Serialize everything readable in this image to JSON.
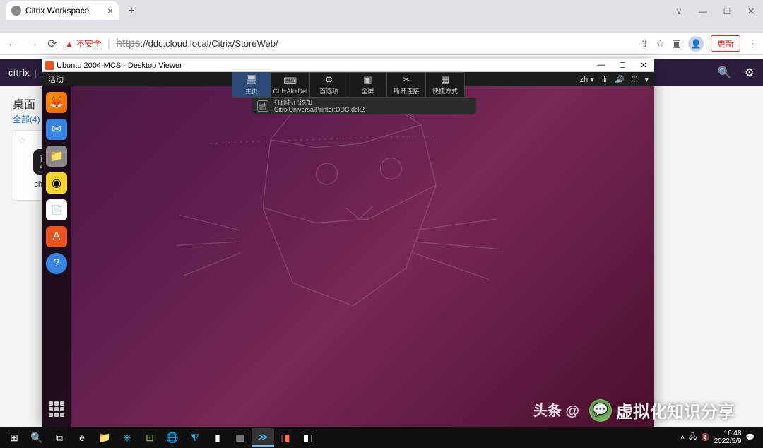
{
  "browser": {
    "tab_title": "Citrix Workspace",
    "security_label": "不安全",
    "url_struck": "https",
    "url": "://ddc.cloud.local/Citrix/StoreWeb/",
    "update_label": "更新"
  },
  "citrix": {
    "brand": "citrⅸ",
    "section": "Sto",
    "sidebar_title": "桌面",
    "sidebar_filter": "全部(4)",
    "card_label": "cheny"
  },
  "viewer": {
    "title": "Ubuntu 2004-MCS - Desktop Viewer",
    "toolbar": {
      "home": "主页",
      "cad": "Ctrl+Alt+Del",
      "prefs": "首选项",
      "fullscreen": "全屏",
      "disconnect": "断开连接",
      "shortcuts": "快捷方式"
    },
    "notif_title": "打印机已添加",
    "notif_body": "CitrixUniversalPrinter:DDC:dsk2"
  },
  "ubuntu": {
    "activities": "活动",
    "lang": "zh ▾"
  },
  "watermark": {
    "prefix": "头条 @",
    "text": "虚拟化知识分享"
  },
  "taskbar": {
    "time": "16:48",
    "date": "2022/5/9"
  }
}
